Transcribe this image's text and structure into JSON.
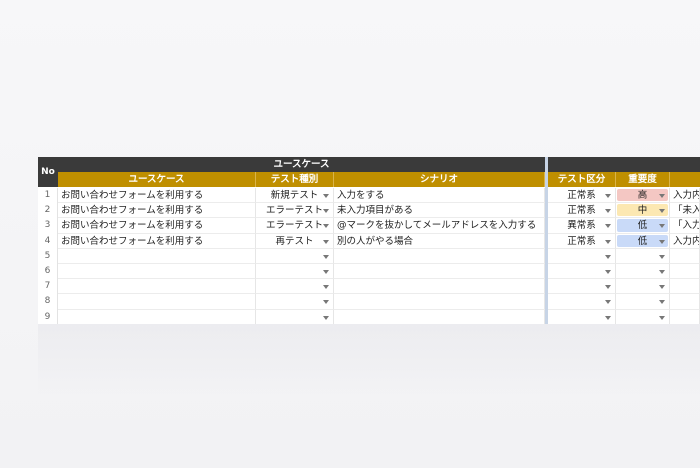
{
  "header": {
    "no": "No",
    "group_usecase": "ユースケース",
    "col_usecase": "ユースケース",
    "col_test_type": "テスト種別",
    "col_scenario": "シナリオ",
    "col_test_category": "テスト区分",
    "col_priority": "重要度"
  },
  "rows": [
    {
      "no": "1",
      "usecase": "お問い合わせフォームを利用する",
      "test_type": "新規テスト",
      "scenario": "入力をする",
      "category": "正常系",
      "priority": "高",
      "next": "入力内"
    },
    {
      "no": "2",
      "usecase": "お問い合わせフォームを利用する",
      "test_type": "エラーテスト",
      "scenario": "未入力項目がある",
      "category": "正常系",
      "priority": "中",
      "next": "「未入"
    },
    {
      "no": "3",
      "usecase": "お問い合わせフォームを利用する",
      "test_type": "エラーテスト",
      "scenario": "@マークを抜かしてメールアドレスを入力する",
      "category": "異常系",
      "priority": "低",
      "next": "「入力"
    },
    {
      "no": "4",
      "usecase": "お問い合わせフォームを利用する",
      "test_type": "再テスト",
      "scenario": "別の人がやる場合",
      "category": "正常系",
      "priority": "低",
      "next": "入力内"
    },
    {
      "no": "5",
      "usecase": "",
      "test_type": "",
      "scenario": "",
      "category": "",
      "priority": "",
      "next": ""
    },
    {
      "no": "6",
      "usecase": "",
      "test_type": "",
      "scenario": "",
      "category": "",
      "priority": "",
      "next": ""
    },
    {
      "no": "7",
      "usecase": "",
      "test_type": "",
      "scenario": "",
      "category": "",
      "priority": "",
      "next": ""
    },
    {
      "no": "8",
      "usecase": "",
      "test_type": "",
      "scenario": "",
      "category": "",
      "priority": "",
      "next": ""
    },
    {
      "no": "9",
      "usecase": "",
      "test_type": "",
      "scenario": "",
      "category": "",
      "priority": "",
      "next": ""
    }
  ],
  "colors": {
    "header_dark": "#3a3a3a",
    "header_gold": "#bf8f00",
    "priority_high": "#f4c7c3",
    "priority_mid": "#fce8b2",
    "priority_low": "#c9daf8"
  }
}
